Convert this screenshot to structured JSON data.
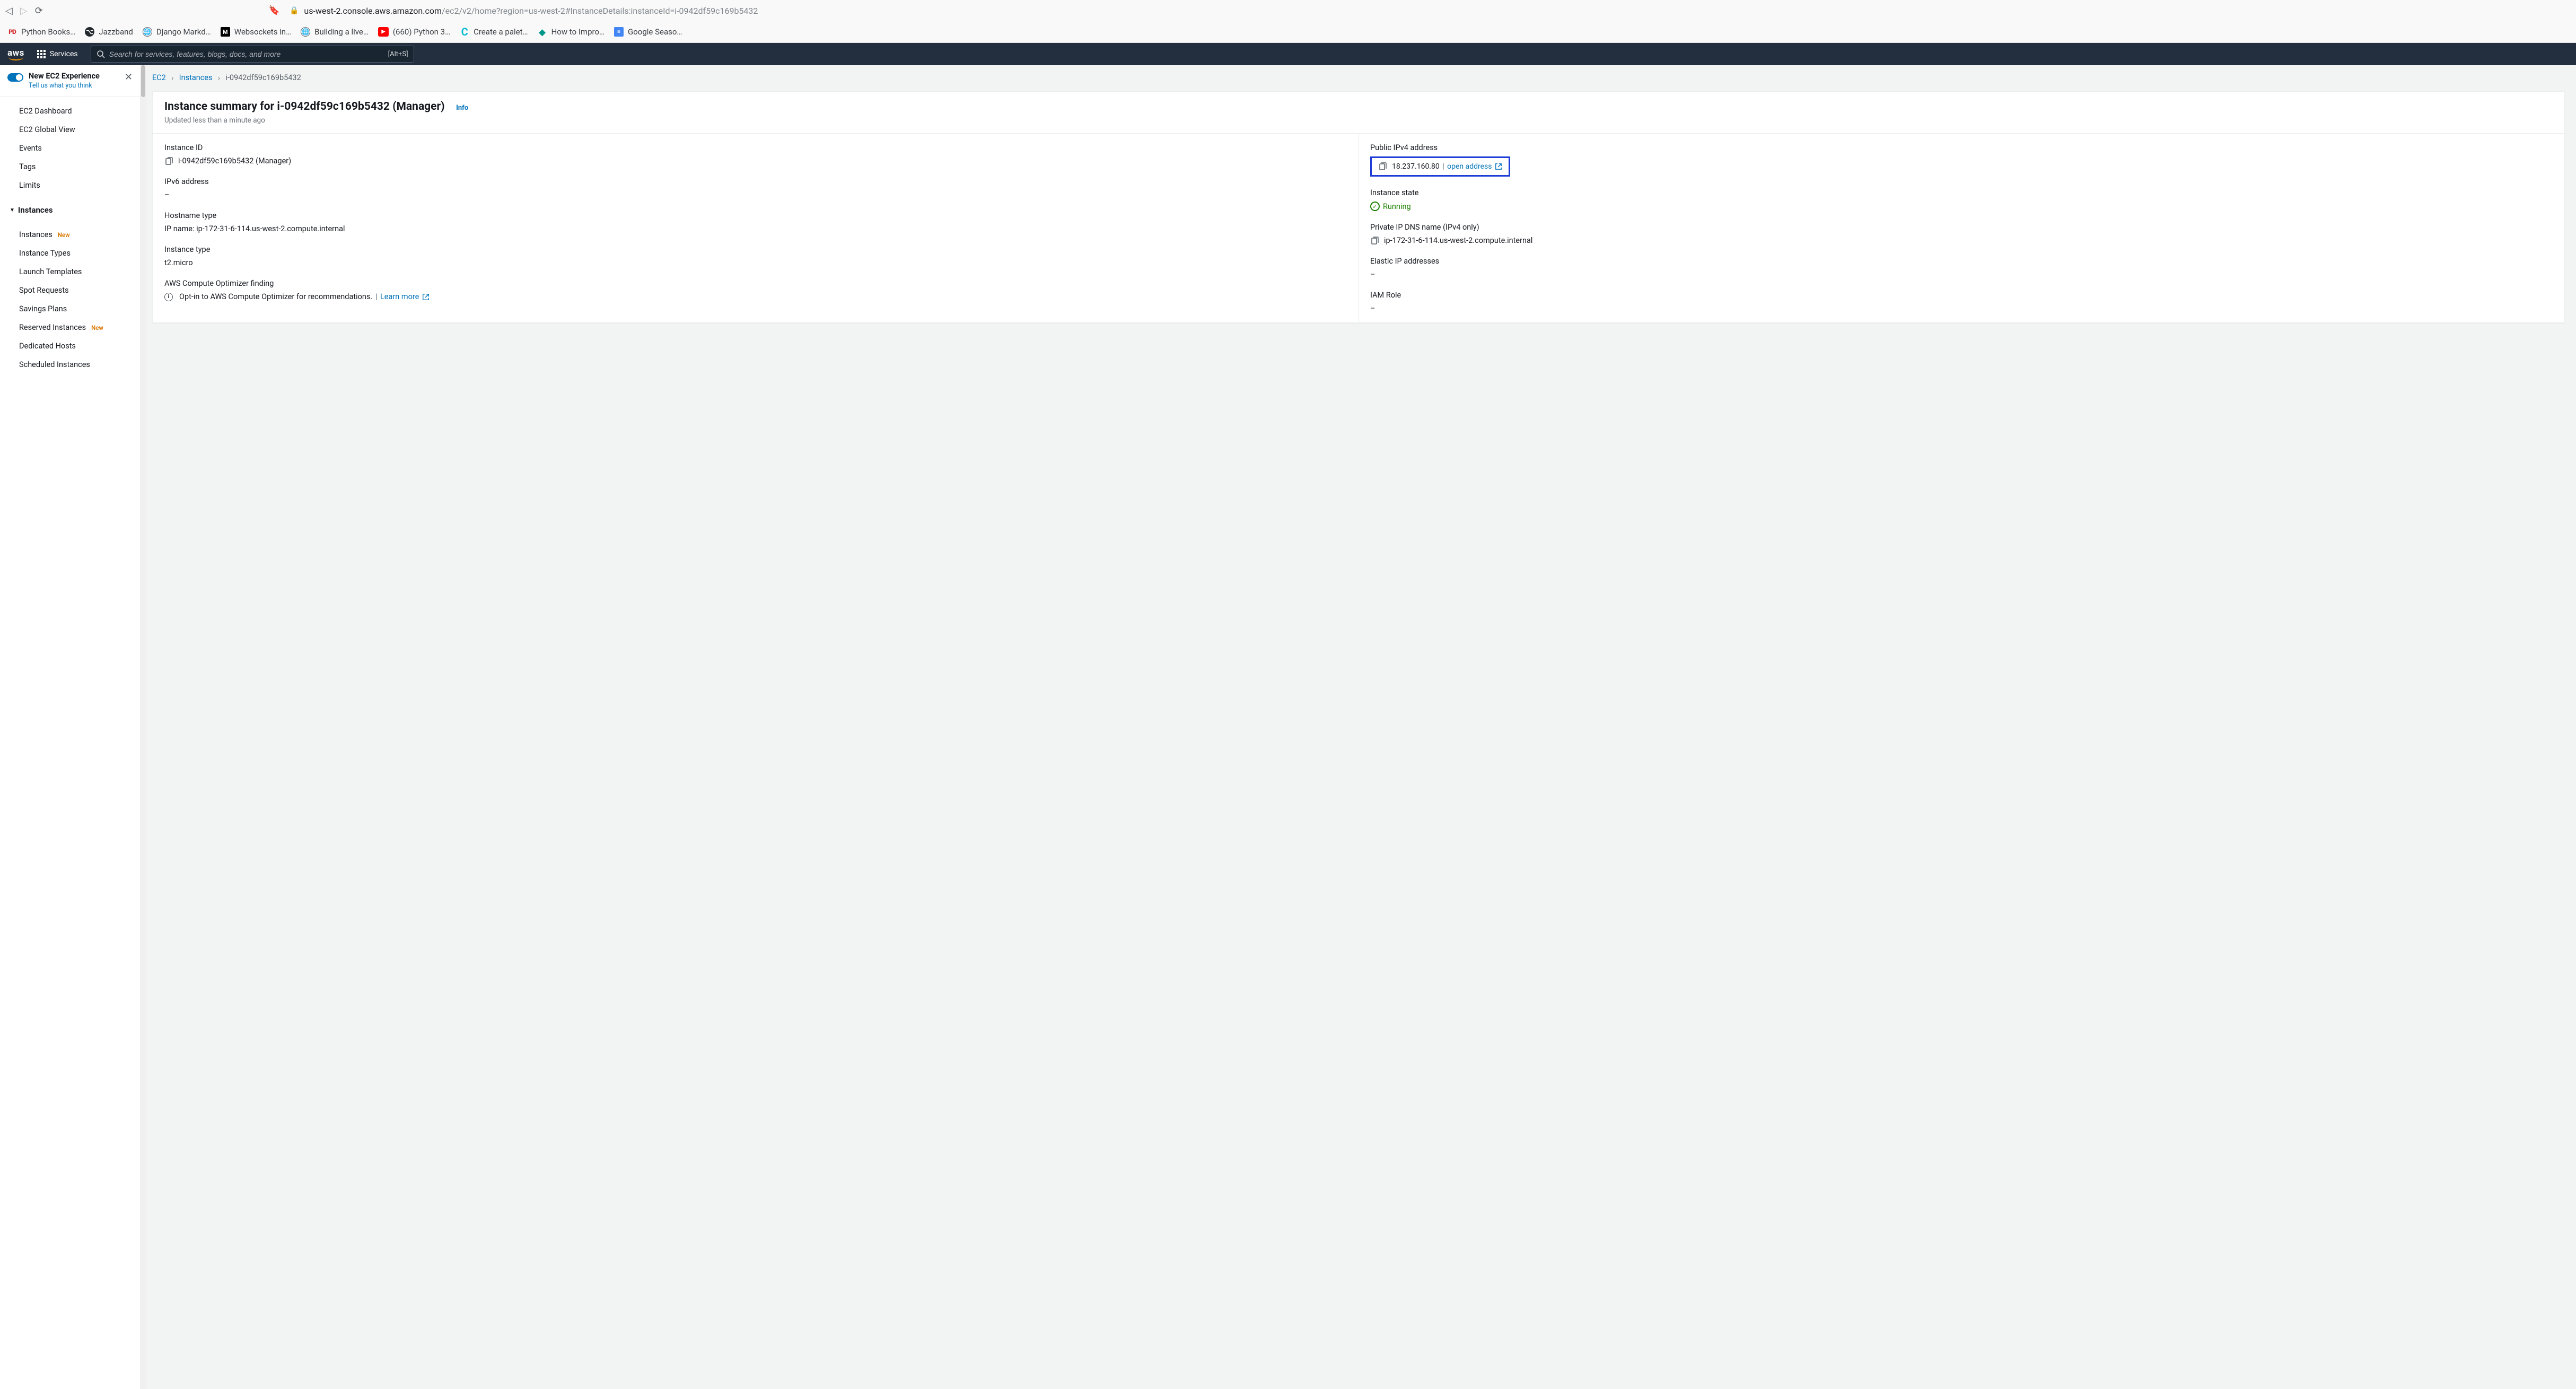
{
  "browser": {
    "url_host": "us-west-2.console.aws.amazon.com",
    "url_path": "/ec2/v2/home?region=us-west-2#InstanceDetails:instanceId=i-0942df59c169b5432",
    "bookmarks": [
      {
        "icon": "pd",
        "label": "Python Books…"
      },
      {
        "icon": "gh",
        "label": "Jazzband"
      },
      {
        "icon": "globe",
        "label": "Django Markd…"
      },
      {
        "icon": "m",
        "label": "Websockets in…"
      },
      {
        "icon": "globe",
        "label": "Building a live…"
      },
      {
        "icon": "yt",
        "label": "(660) Python 3…"
      },
      {
        "icon": "c",
        "label": "Create a palet…"
      },
      {
        "icon": "diamond",
        "label": "How to Impro…"
      },
      {
        "icon": "gdoc",
        "label": "Google Seaso…"
      }
    ]
  },
  "aws_header": {
    "logo": "aws",
    "services": "Services",
    "search_placeholder": "Search for services, features, blogs, docs, and more",
    "shortcut": "[Alt+S]"
  },
  "sidebar": {
    "experience": {
      "title": "New EC2 Experience",
      "subtitle": "Tell us what you think"
    },
    "top_items": [
      "EC2 Dashboard",
      "EC2 Global View",
      "Events",
      "Tags",
      "Limits"
    ],
    "instances_header": "Instances",
    "instances_items": [
      {
        "label": "Instances",
        "new": true
      },
      {
        "label": "Instance Types",
        "new": false
      },
      {
        "label": "Launch Templates",
        "new": false
      },
      {
        "label": "Spot Requests",
        "new": false
      },
      {
        "label": "Savings Plans",
        "new": false
      },
      {
        "label": "Reserved Instances",
        "new": true
      },
      {
        "label": "Dedicated Hosts",
        "new": false
      },
      {
        "label": "Scheduled Instances",
        "new": false
      }
    ],
    "new_badge": "New"
  },
  "breadcrumbs": {
    "root": "EC2",
    "mid": "Instances",
    "current": "i-0942df59c169b5432"
  },
  "summary": {
    "title": "Instance summary for i-0942df59c169b5432 (Manager)",
    "info": "Info",
    "updated": "Updated less than a minute ago",
    "left": {
      "instance_id_label": "Instance ID",
      "instance_id_value": "i-0942df59c169b5432 (Manager)",
      "ipv6_label": "IPv6 address",
      "ipv6_value": "–",
      "hostname_label": "Hostname type",
      "hostname_value": "IP name: ip-172-31-6-114.us-west-2.compute.internal",
      "instance_type_label": "Instance type",
      "instance_type_value": "t2.micro",
      "optimizer_label": "AWS Compute Optimizer finding",
      "optimizer_text": "Opt-in to AWS Compute Optimizer for recommendations. ",
      "learn_more": "Learn more"
    },
    "right": {
      "public_ipv4_label": "Public IPv4 address",
      "public_ipv4_value": "18.237.160.80",
      "open_address": "open address",
      "state_label": "Instance state",
      "state_value": "Running",
      "private_dns_label": "Private IP DNS name (IPv4 only)",
      "private_dns_value": "ip-172-31-6-114.us-west-2.compute.internal",
      "elastic_ip_label": "Elastic IP addresses",
      "elastic_ip_value": "–",
      "iam_label": "IAM Role",
      "iam_value": "–"
    }
  }
}
